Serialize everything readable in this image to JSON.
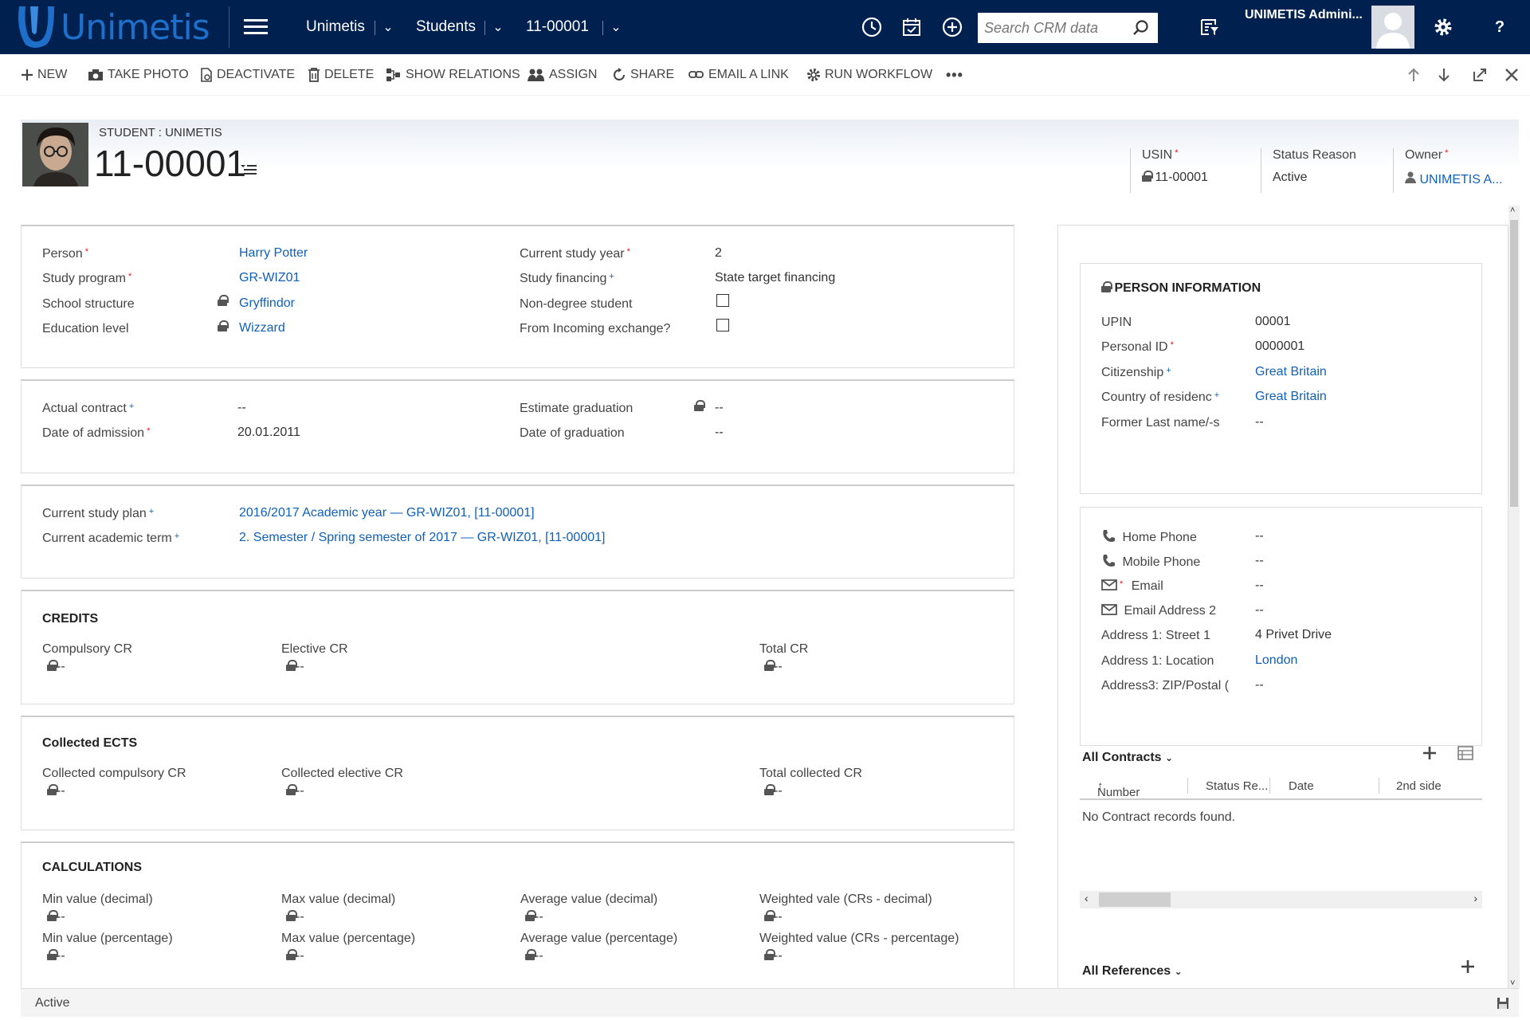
{
  "nav": {
    "logo_text": "Unimetis",
    "breadcrumb": [
      "Unimetis",
      "Students",
      "11-00001"
    ],
    "search_placeholder": "Search CRM data",
    "user_name": "UNIMETIS Admini...",
    "help": "?"
  },
  "commands": [
    "NEW",
    "TAKE PHOTO",
    "DEACTIVATE",
    "DELETE",
    "SHOW RELATIONS",
    "ASSIGN",
    "SHARE",
    "EMAIL A LINK",
    "RUN WORKFLOW",
    "•••"
  ],
  "header": {
    "entity_label": "STUDENT : UNIMETIS",
    "title": "11-00001",
    "fields": [
      {
        "label": "USIN",
        "value": "11-00001"
      },
      {
        "label": "Status Reason",
        "value": "Active"
      },
      {
        "label": "Owner",
        "value": "UNIMETIS A..."
      }
    ]
  },
  "general": {
    "person_label": "Person",
    "person": "Harry Potter",
    "program_label": "Study program",
    "program": "GR-WIZ01",
    "school_label": "School structure",
    "school": "Gryffindor",
    "level_label": "Education level",
    "level": "Wizzard",
    "year_label": "Current study year",
    "year": "2",
    "financing_label": "Study financing",
    "financing": "State target financing",
    "nondegree_label": "Non-degree student",
    "incoming_label": "From Incoming exchange?"
  },
  "contract": {
    "actual_label": "Actual contract",
    "actual": "--",
    "admission_label": "Date of admission",
    "admission": "20.01.2011",
    "estimate_label": "Estimate graduation",
    "estimate": "--",
    "graduation_label": "Date of graduation",
    "graduation": "--"
  },
  "plan": {
    "plan_label": "Current study plan",
    "plan": "2016/2017 Academic year — GR-WIZ01, [11-00001]",
    "term_label": "Current academic term",
    "term": "2. Semester / Spring semester of 2017 — GR-WIZ01, [11-00001]"
  },
  "credits": {
    "title": "CREDITS",
    "fields": [
      {
        "label": "Compulsory CR",
        "value": "--"
      },
      {
        "label": "Elective CR",
        "value": "--"
      },
      {
        "label": "Total CR",
        "value": "--"
      }
    ]
  },
  "ects": {
    "title": "Collected ECTS",
    "fields": [
      {
        "label": "Collected compulsory CR",
        "value": "--"
      },
      {
        "label": "Collected elective CR",
        "value": "--"
      },
      {
        "label": "Total collected CR",
        "value": "--"
      }
    ]
  },
  "calc": {
    "title": "CALCULATIONS",
    "fields": [
      {
        "label": "Min value (decimal)",
        "value": "--"
      },
      {
        "label": "Max value (decimal)",
        "value": "--"
      },
      {
        "label": "Average value (decimal)",
        "value": "--"
      },
      {
        "label": "Weighted vale (CRs - decimal)",
        "value": "--"
      },
      {
        "label": "Min value (percentage)",
        "value": "--"
      },
      {
        "label": "Max value (percentage)",
        "value": "--"
      },
      {
        "label": "Average value (percentage)",
        "value": "--"
      },
      {
        "label": "Weighted value (CRs - percentage)",
        "value": "--"
      }
    ]
  },
  "person_info": {
    "title": "PERSON INFORMATION",
    "upin_label": "UPIN",
    "upin": "00001",
    "pid_label": "Personal ID",
    "pid": "0000001",
    "cit_label": "Citizenship",
    "cit": "Great Britain",
    "cor_label": "Country of residenc",
    "cor": "Great Britain",
    "former_label": "Former Last name/-s",
    "former": "--"
  },
  "contact": {
    "home_label": "Home Phone",
    "home": "--",
    "mobile_label": "Mobile Phone",
    "mobile": "--",
    "email_label": "Email",
    "email": "--",
    "email2_label": "Email Address 2",
    "email2": "--",
    "street_label": "Address 1: Street 1",
    "street": "4 Privet Drive",
    "loc_label": "Address 1: Location",
    "loc": "London",
    "zip_label": "Address3: ZIP/Postal (",
    "zip": "--"
  },
  "contracts_grid": {
    "title": "All Contracts",
    "columns": [
      "Number",
      "Status Re...",
      "Date",
      "2nd side"
    ],
    "empty": "No Contract records found."
  },
  "references": {
    "title": "All References"
  },
  "status_bar": {
    "text": "Active"
  },
  "colors": {
    "nav": "#002050",
    "link": "#1160b7",
    "required": "#e11111"
  }
}
